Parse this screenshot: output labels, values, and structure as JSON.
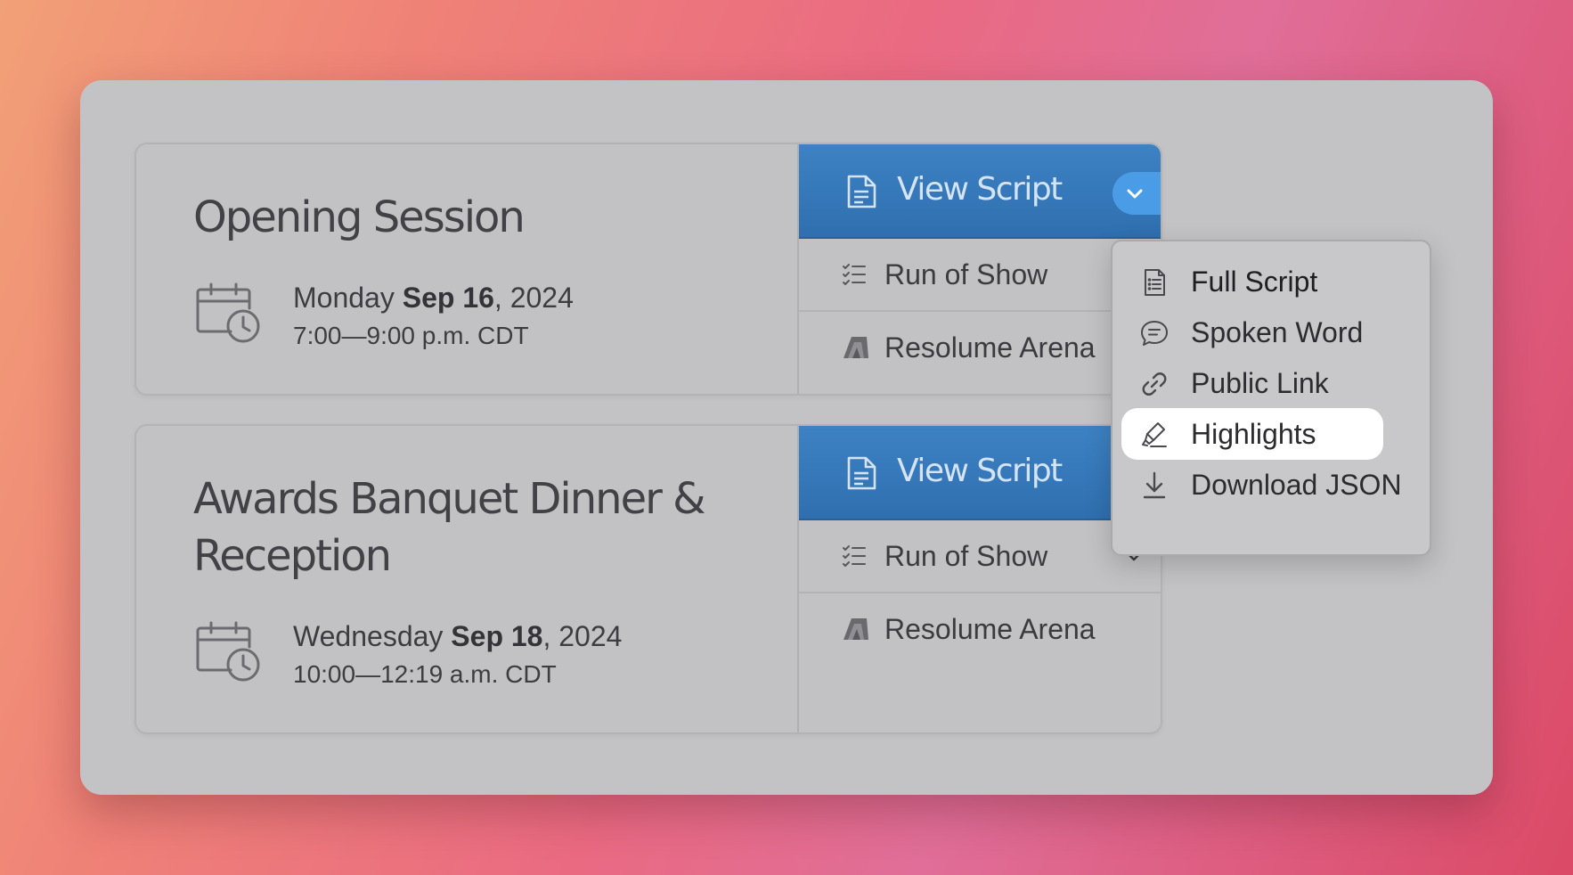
{
  "events": [
    {
      "title": "Opening Session",
      "date_weekday": "Monday ",
      "date_bold": "Sep 16",
      "date_year": ", 2024",
      "time": "7:00—9:00 p.m. CDT",
      "view_script_label": "View Script",
      "run_of_show_label": "Run of Show",
      "resolume_label": "Resolume Arena"
    },
    {
      "title": "Awards Banquet Dinner & Reception",
      "date_weekday": "Wednesday ",
      "date_bold": "Sep 18",
      "date_year": ", 2024",
      "time": "10:00—12:19 a.m. CDT",
      "view_script_label": "View Script",
      "run_of_show_label": "Run of Show",
      "resolume_label": "Resolume Arena"
    }
  ],
  "dropdown_menu": {
    "items": [
      {
        "label": "Full Script",
        "icon": "document-list-icon"
      },
      {
        "label": "Spoken Word",
        "icon": "speech-bubble-icon"
      },
      {
        "label": "Public Link",
        "icon": "link-icon"
      },
      {
        "label": "Highlights",
        "icon": "highlighter-icon",
        "active": true
      },
      {
        "label": "Download JSON",
        "icon": "download-icon"
      }
    ]
  },
  "colors": {
    "primary_button": "#3a7dc0",
    "dropdown_toggle": "#4a9ce6",
    "panel": "#c3c3c5",
    "active_item": "#ffffff"
  }
}
